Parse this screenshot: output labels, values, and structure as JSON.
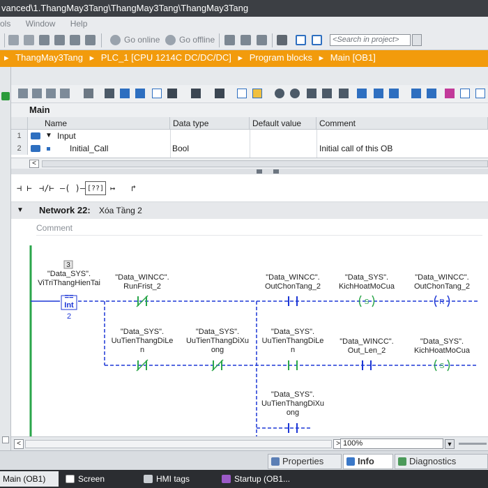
{
  "window": {
    "title": "vanced\\1.ThangMay3Tang\\ThangMay3Tang\\ThangMay3Tang"
  },
  "menu": {
    "items": [
      "ols",
      "Window",
      "Help"
    ]
  },
  "toolbar": {
    "go_online": "Go online",
    "go_offline": "Go offline",
    "search_placeholder": "<Search in project>"
  },
  "breadcrumb": {
    "items": [
      "ThangMay3Tang",
      "PLC_1 [CPU 1214C DC/DC/DC]",
      "Program blocks",
      "Main [OB1]"
    ],
    "separator": "▸"
  },
  "block": {
    "title": "Main"
  },
  "interface": {
    "columns": [
      "Name",
      "Data type",
      "Default value",
      "Comment"
    ],
    "rows": [
      {
        "num": "1",
        "name": "Input",
        "type": "",
        "default": "",
        "comment": ""
      },
      {
        "num": "2",
        "name": "Initial_Call",
        "type": "Bool",
        "default": "",
        "comment": "Initial call of this OB"
      }
    ]
  },
  "ladder_toolbar": {
    "items": [
      "⊣ ⊢",
      "⊣/⊢",
      "–( )–",
      "[??]",
      "↦",
      "↱"
    ]
  },
  "network": {
    "title": "Network 22:",
    "subtitle": "Xóa Tầng 2",
    "comment_placeholder": "Comment",
    "cmp": {
      "value": "3",
      "tag": "\"Data_SYS\".\nViTriThangHienTai",
      "op": "==",
      "type": "Int",
      "rhs": "2"
    },
    "row1": [
      {
        "tag": "\"Data_WINCC\".\nRunFrist_2",
        "kind": "NC"
      },
      {
        "tag": "\"Data_WINCC\".\nOutChonTang_2",
        "kind": "NO"
      },
      {
        "tag": "\"Data_SYS\".\nKichHoatMoCua",
        "kind": "S"
      },
      {
        "tag": "\"Data_WINCC\".\nOutChonTang_2",
        "kind": "R"
      }
    ],
    "row2": [
      {
        "tag": "\"Data_SYS\".\nUuTienThangDiLe\nn",
        "kind": "NC"
      },
      {
        "tag": "\"Data_SYS\".\nUuTienThangDiXu\nong",
        "kind": "NC"
      },
      {
        "tag": "\"Data_SYS\".\nUuTienThangDiLe\nn",
        "kind": "NO"
      },
      {
        "tag": "\"Data_WINCC\".\nOut_Len_2",
        "kind": "NO"
      },
      {
        "tag": "\"Data_SYS\".\nKichHoatMoCua",
        "kind": "S"
      }
    ],
    "row3": [
      {
        "tag": "\"Data_SYS\".\nUuTienThangDiXu\nong",
        "kind": "NO"
      }
    ]
  },
  "zoom": "100%",
  "properties_tabs": [
    "Properties",
    "Info",
    "Diagnostics"
  ],
  "taskbar": [
    "Main (OB1)",
    "Screen",
    "HMI tags",
    "Startup (OB1..."
  ],
  "colors": {
    "accent": "#f29b0c",
    "wire": "#1c36d6",
    "editor_bg": "#ffffff"
  }
}
